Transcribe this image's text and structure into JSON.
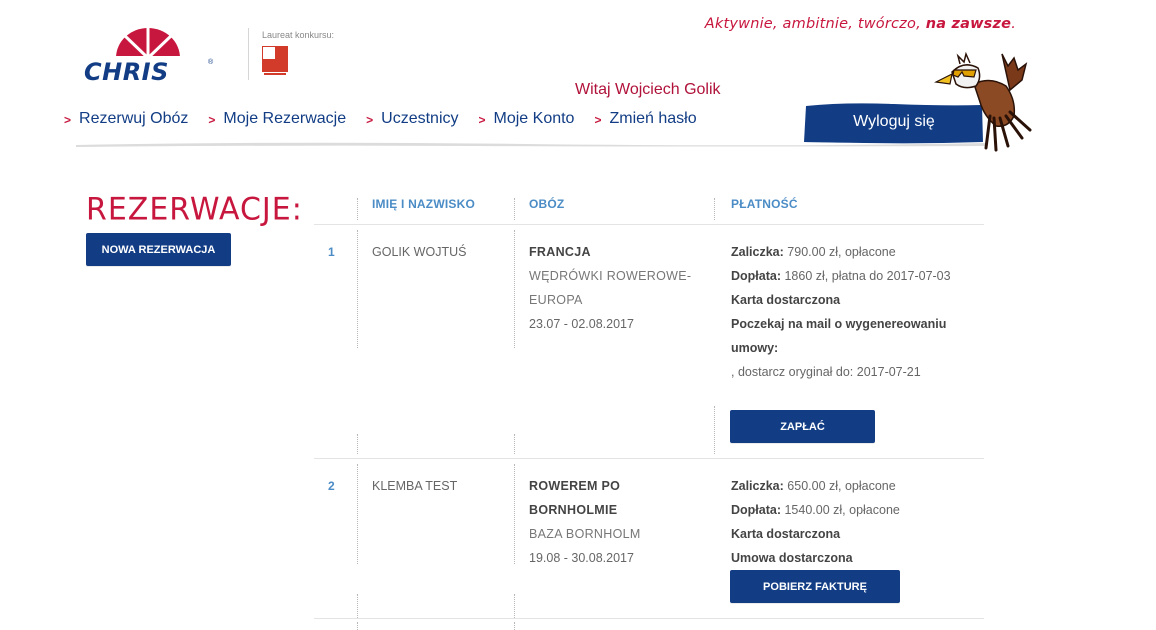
{
  "header": {
    "logo_text": "CHRIS",
    "logo_reg": "®",
    "laureat_label": "Laureat konkursu:",
    "slogan_regular": "Aktywnie, ambitnie, twórczo,",
    "slogan_bold": "na zawsze",
    "slogan_end": ".",
    "welcome": "Witaj Wojciech Golik",
    "logout_label": "Wyloguj się",
    "brand_color": "#123d85",
    "accent_color": "#c8173e"
  },
  "nav": {
    "arrow": ">",
    "items": [
      {
        "label": "Rezerwuj Obóz"
      },
      {
        "label": "Moje Rezerwacje"
      },
      {
        "label": "Uczestnicy"
      },
      {
        "label": "Moje Konto"
      },
      {
        "label": "Zmień hasło"
      }
    ]
  },
  "page": {
    "title": "REZERWACJE:",
    "new_button": "NOWA REZERWACJA"
  },
  "table": {
    "headers": [
      "IMIĘ I NAZWISKO",
      "OBÓZ",
      "PŁATNOŚĆ"
    ],
    "rows": [
      {
        "num": "1",
        "name": "GOLIK WOJTUŚ",
        "camp": "FRANCJA",
        "camp_sub_1": "WĘDRÓWKI ROWEROWE-",
        "camp_sub_2": "EUROPA",
        "dates": "23.07 - 02.08.2017",
        "zaliczka_label": "Zaliczka:",
        "zaliczka_value": "790.00 zł, opłacone",
        "doplata_label": "Dopłata:",
        "doplata_value": "1860 zł, płatna do 2017-07-03",
        "status_1": "Karta dostarczona",
        "status_2a": "Poczekaj na mail o wygenereowaniu",
        "status_2b": "umowy:",
        "status_3": ", dostarcz oryginał do: 2017-07-21",
        "button": "ZAPŁAĆ"
      },
      {
        "num": "2",
        "name": "KLEMBA TEST",
        "camp_1": "ROWEREM PO",
        "camp_2": "BORNHOLMIE",
        "camp_sub": "BAZA BORNHOLM",
        "dates": "19.08 - 30.08.2017",
        "zaliczka_label": "Zaliczka:",
        "zaliczka_value": "650.00 zł, opłacone",
        "doplata_label": "Dopłata:",
        "doplata_value": "1540.00 zł, opłacone",
        "status_1": "Karta dostarczona",
        "status_2": "Umowa dostarczona",
        "button": "POBIERZ FAKTURĘ"
      }
    ]
  }
}
